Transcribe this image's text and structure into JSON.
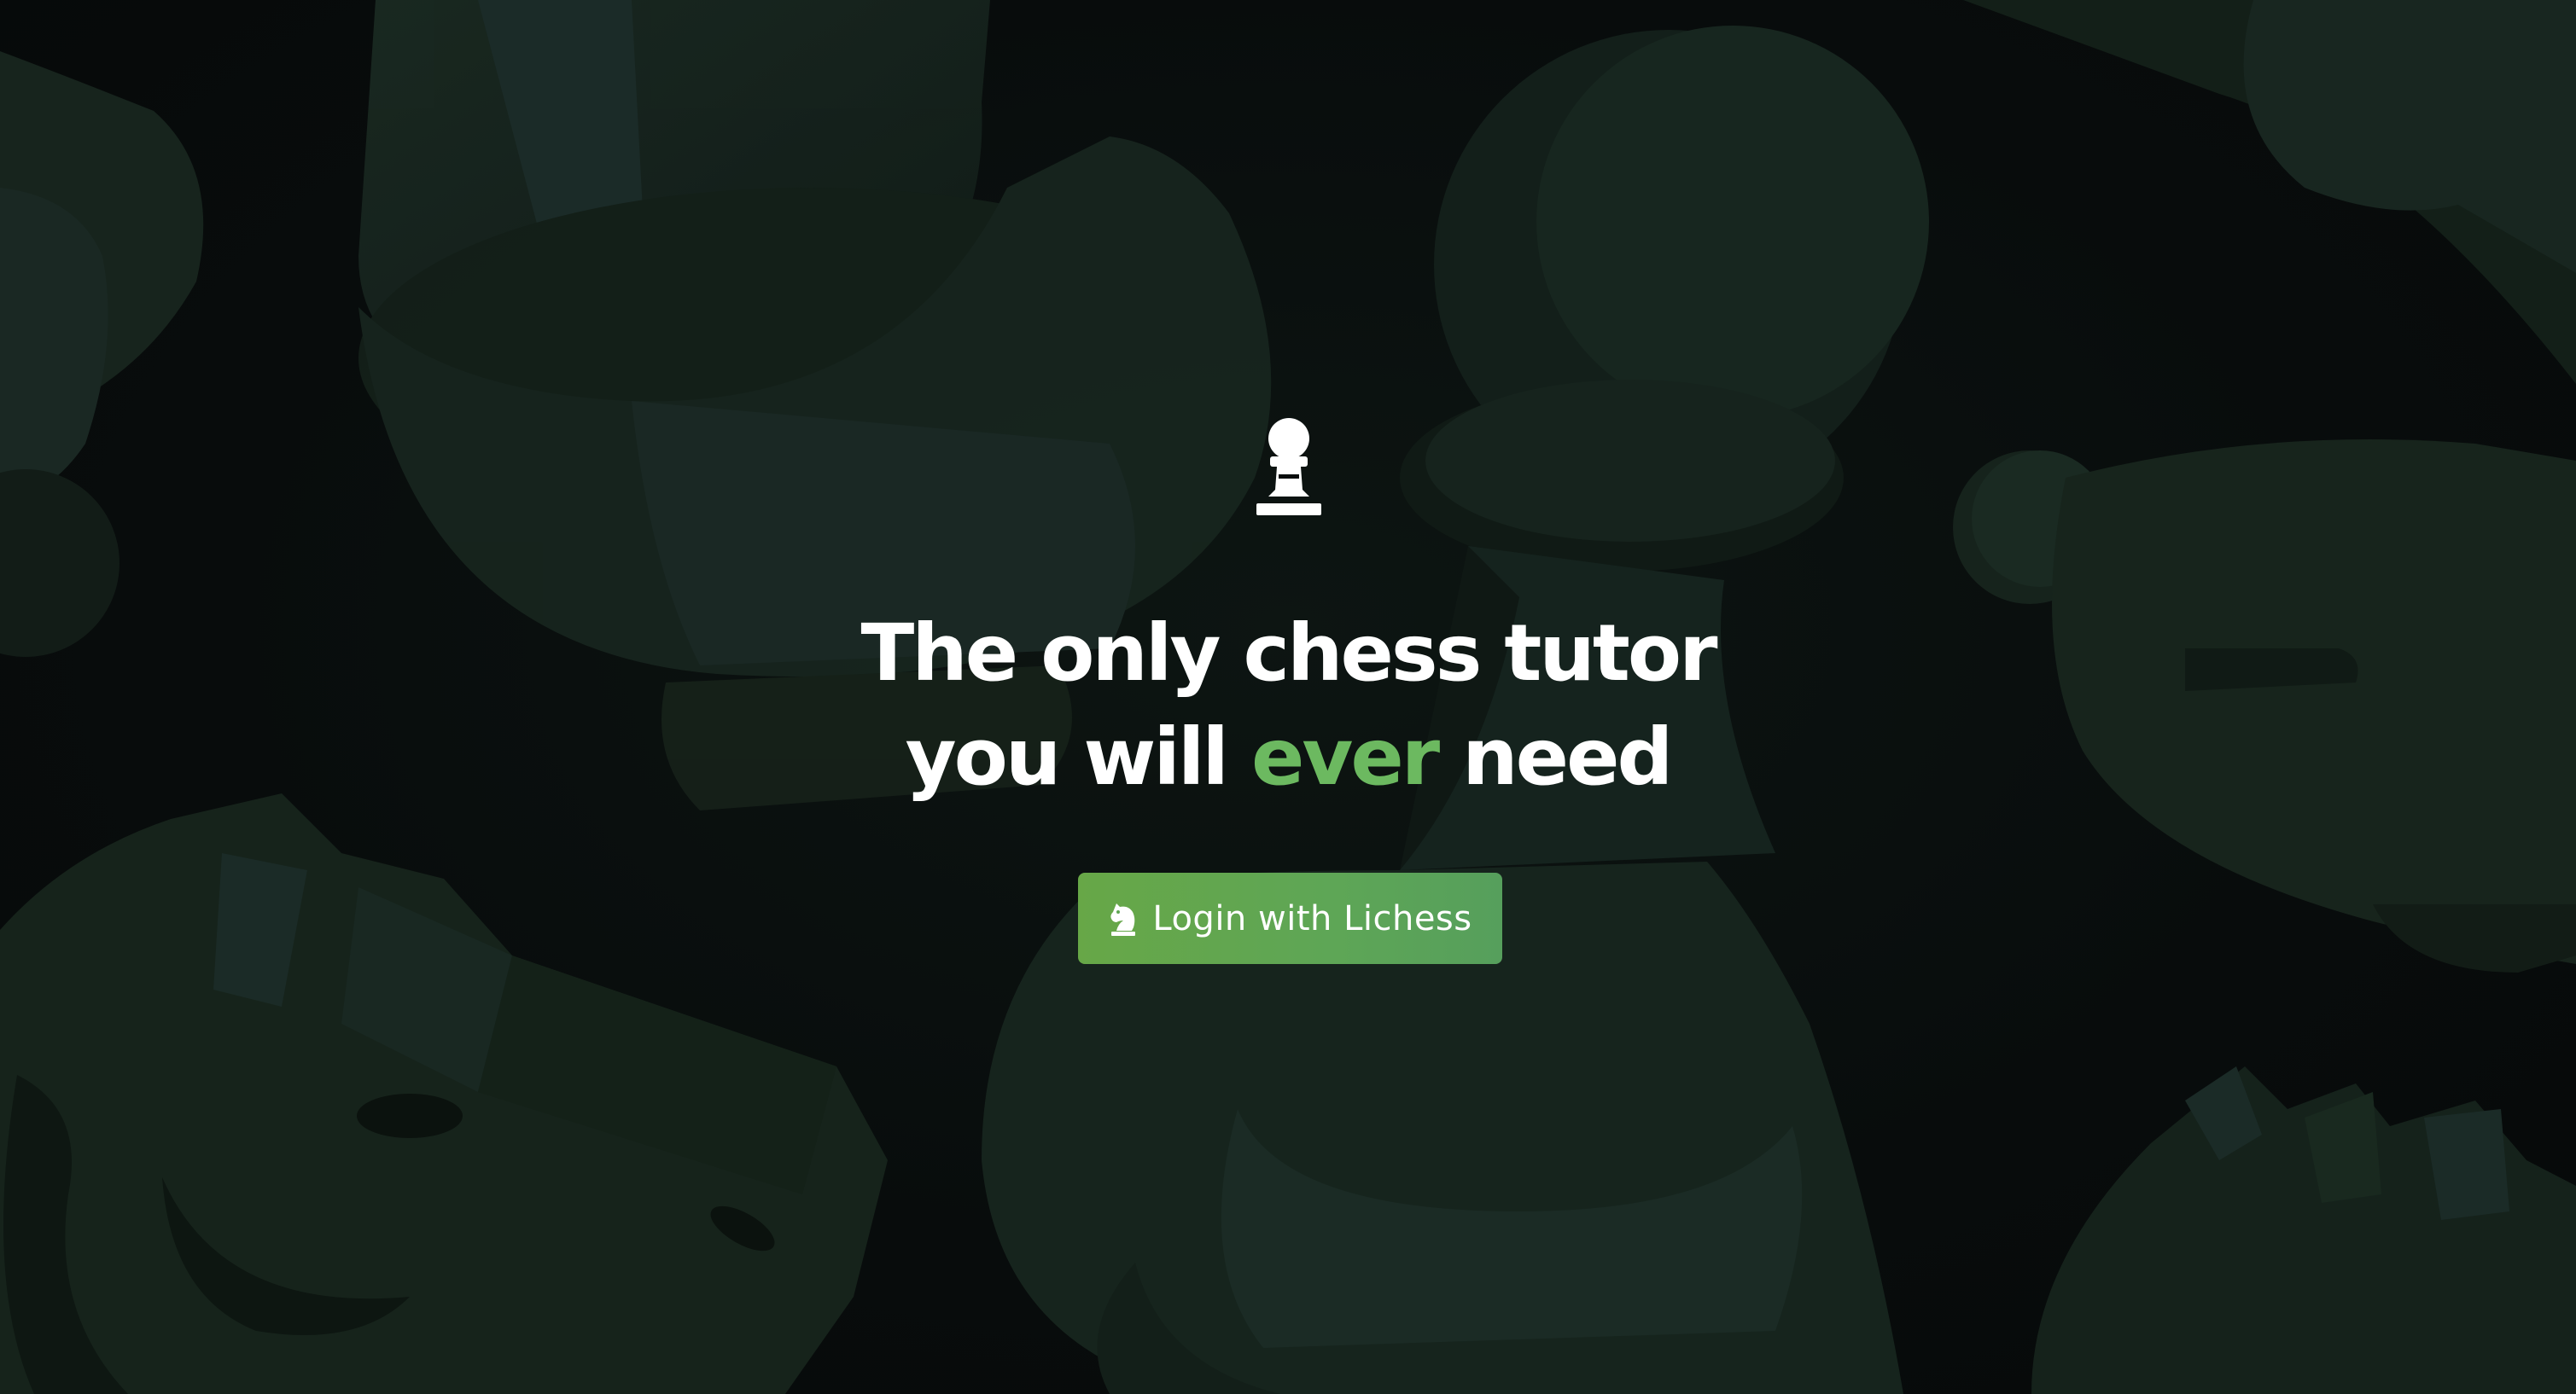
{
  "hero": {
    "headline_line1": "The only chess tutor",
    "headline_line2_pre": "you will ",
    "headline_line2_accent": "ever",
    "headline_line2_post": " need"
  },
  "login_button": {
    "label": "Login with Lichess",
    "icon": "lichess-knight-icon"
  },
  "logo": {
    "icon": "chess-pawn-icon"
  },
  "colors": {
    "background": "#080d0d",
    "accent_text": "#6cb960",
    "button": "#5fa653",
    "text": "#ffffff"
  }
}
